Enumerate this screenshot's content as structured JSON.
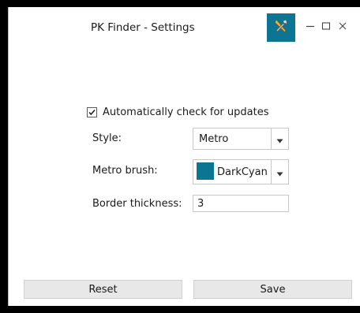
{
  "window": {
    "title": "PK Finder - Settings",
    "accent_color": "#0b7593"
  },
  "titlebar": {
    "settings_icon": "tools-icon",
    "minimize_icon": "minimize-icon",
    "maximize_icon": "maximize-icon",
    "close_icon": "close-icon"
  },
  "settings": {
    "auto_update": {
      "label": "Automatically check for updates",
      "checked": true
    },
    "style": {
      "label": "Style:",
      "value": "Metro"
    },
    "metro_brush": {
      "label": "Metro brush:",
      "value": "DarkCyan",
      "swatch_color": "#0b7593"
    },
    "border_thickness": {
      "label": "Border thickness:",
      "value": "3"
    }
  },
  "buttons": {
    "reset_label": "Reset",
    "save_label": "Save"
  }
}
